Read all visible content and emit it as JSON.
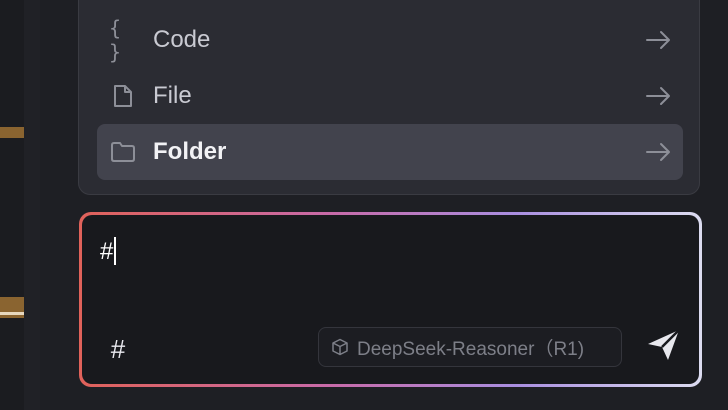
{
  "menu": {
    "items": [
      {
        "label": "Code",
        "icon": "code-braces-icon",
        "selected": false
      },
      {
        "label": "File",
        "icon": "file-icon",
        "selected": false
      },
      {
        "label": "Folder",
        "icon": "folder-icon",
        "selected": true
      }
    ],
    "code_glyph": "{ }"
  },
  "input": {
    "value": "#",
    "hash_label": "#"
  },
  "model": {
    "label": "DeepSeek-Reasoner（R1)"
  },
  "colors": {
    "background": "#1e1f24",
    "menu_bg": "#2b2c33",
    "selected_bg": "#42434d",
    "gradient_start": "#e0625a",
    "gradient_mid": "#c86aa8",
    "gradient_end": "#dcdcf0"
  }
}
